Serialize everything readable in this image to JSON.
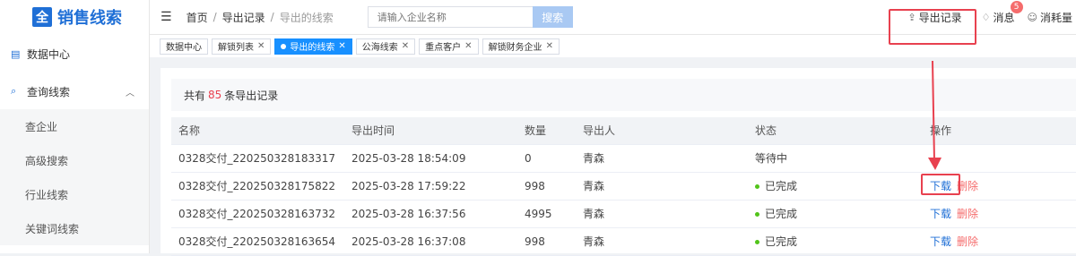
{
  "logo": {
    "badge": "全",
    "title": "销售线索"
  },
  "sidebar": {
    "items": [
      {
        "label": "数据中心",
        "icon": "data-center-icon"
      },
      {
        "label": "查询线索",
        "icon": "search-clue-icon"
      }
    ],
    "subitems": [
      "查企业",
      "高级搜索",
      "行业线索",
      "关键词线索"
    ]
  },
  "breadcrumb": [
    "首页",
    "导出记录",
    "导出的线索"
  ],
  "search": {
    "placeholder": "请输入企业名称",
    "button": "搜索"
  },
  "topRight": {
    "export": "导出记录",
    "message": "消息",
    "messageCount": "5",
    "usage": "消耗量"
  },
  "tags": [
    {
      "label": "数据中心",
      "closable": false,
      "active": false
    },
    {
      "label": "解锁列表",
      "closable": true,
      "active": false
    },
    {
      "label": "导出的线索",
      "closable": true,
      "active": true
    },
    {
      "label": "公海线索",
      "closable": true,
      "active": false
    },
    {
      "label": "重点客户",
      "closable": true,
      "active": false
    },
    {
      "label": "解锁财务企业",
      "closable": true,
      "active": false
    }
  ],
  "summary": {
    "prefix": "共有",
    "count": "85",
    "suffix": "条导出记录"
  },
  "table": {
    "headers": [
      "名称",
      "导出时间",
      "数量",
      "导出人",
      "状态",
      "操作"
    ],
    "rows": [
      {
        "name": "0328交付_220250328183317",
        "time": "2025-03-28 18:54:09",
        "qty": "0",
        "user": "青森",
        "status": "等待中",
        "done": false
      },
      {
        "name": "0328交付_220250328175822",
        "time": "2025-03-28 17:59:22",
        "qty": "998",
        "user": "青森",
        "status": "已完成",
        "done": true
      },
      {
        "name": "0328交付_220250328163732",
        "time": "2025-03-28 16:37:56",
        "qty": "4995",
        "user": "青森",
        "status": "已完成",
        "done": true
      },
      {
        "name": "0328交付_220250328163654",
        "time": "2025-03-28 16:37:08",
        "qty": "998",
        "user": "青森",
        "status": "已完成",
        "done": true
      }
    ],
    "actions": {
      "download": "下载",
      "delete": "删除"
    }
  },
  "colors": {
    "primary": "#1f6fd6",
    "highlight": "#e8414f",
    "success": "#52c41a"
  }
}
